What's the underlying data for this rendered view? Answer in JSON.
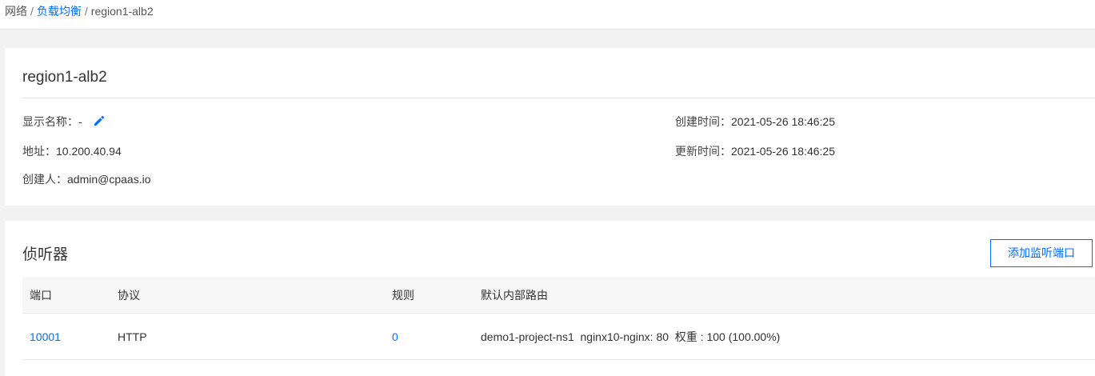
{
  "breadcrumb": {
    "root": "网络",
    "sep": "/",
    "parent": "负载均衡",
    "current": "region1-alb2"
  },
  "info": {
    "title": "region1-alb2",
    "display_name_label": "显示名称：",
    "display_name_value": "-",
    "address_label": "地址：",
    "address_value": "10.200.40.94",
    "creator_label": "创建人：",
    "creator_value": "admin@cpaas.io",
    "created_label": "创建时间：",
    "created_value": "2021-05-26 18:46:25",
    "updated_label": "更新时间：",
    "updated_value": "2021-05-26 18:46:25",
    "edit_icon": "pencil-icon"
  },
  "listeners": {
    "title": "侦听器",
    "add_button": "添加监听端口",
    "columns": [
      "端口",
      "协议",
      "规则",
      "默认内部路由"
    ],
    "rows": [
      {
        "port": "10001",
        "protocol": "HTTP",
        "rules": "0",
        "route": "demo1-project-ns1  nginx10-nginx: 80  权重 : 100 (100.00%)"
      }
    ]
  },
  "colors": {
    "accent": "#006eff",
    "background": "#f2f2f2",
    "card": "#ffffff",
    "table_header": "#f7f7f7"
  }
}
